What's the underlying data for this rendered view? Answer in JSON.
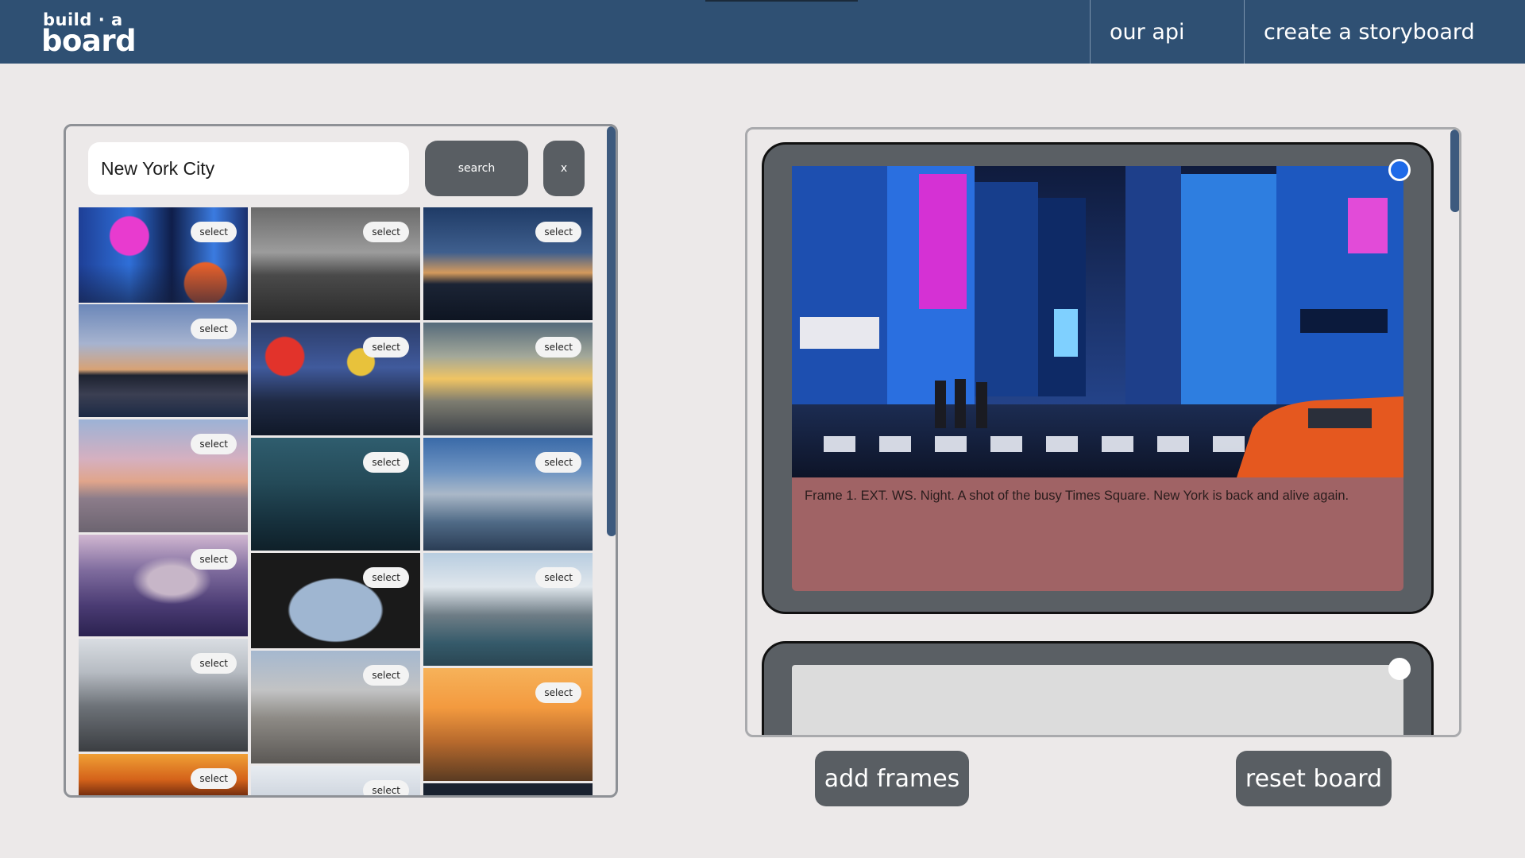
{
  "header": {
    "logo_line1": "build · a",
    "logo_line2": "board",
    "nav": [
      {
        "label": "our api"
      },
      {
        "label": "create a storyboard"
      }
    ]
  },
  "search": {
    "query": "New York City",
    "search_label": "search",
    "clear_label": "x",
    "select_label": "select"
  },
  "results": {
    "columns": [
      [
        {
          "icon": "times-square-photo"
        },
        {
          "icon": "skyline-dusk-photo"
        },
        {
          "icon": "empire-state-sunset-photo"
        },
        {
          "icon": "aerial-manhattan-photo"
        },
        {
          "icon": "empire-state-day-photo"
        },
        {
          "icon": "orange-sunset-photo"
        }
      ],
      [
        {
          "icon": "brooklyn-bridge-bw-photo"
        },
        {
          "icon": "times-square-night-photo"
        },
        {
          "icon": "city-night-teal-photo"
        },
        {
          "icon": "manhattan-bridge-arch-photo"
        },
        {
          "icon": "empire-state-morning-photo"
        },
        {
          "icon": "statue-of-liberty-photo"
        }
      ],
      [
        {
          "icon": "skyline-blue-hour-photo"
        },
        {
          "icon": "broken-glass-empire-state-photo"
        },
        {
          "icon": "midtown-clouds-photo"
        },
        {
          "icon": "downtown-bridge-photo"
        },
        {
          "icon": "empire-state-golden-photo"
        },
        {
          "icon": "dark-photo"
        }
      ]
    ]
  },
  "board": {
    "frames": [
      {
        "caption": "Frame 1. EXT. WS. Night. A shot of the busy Times Square. New York is back and alive again.",
        "selected": true,
        "image_icon": "times-square-frame-photo"
      },
      {
        "caption": "",
        "selected": false
      }
    ],
    "add_frames_label": "add frames",
    "reset_board_label": "reset board"
  },
  "colors": {
    "header_bg": "#2f5073",
    "button_bg": "#595e63",
    "caption_bg": "#a06365",
    "accent_blue": "#1e6ae8",
    "page_bg": "#ece9e9"
  }
}
